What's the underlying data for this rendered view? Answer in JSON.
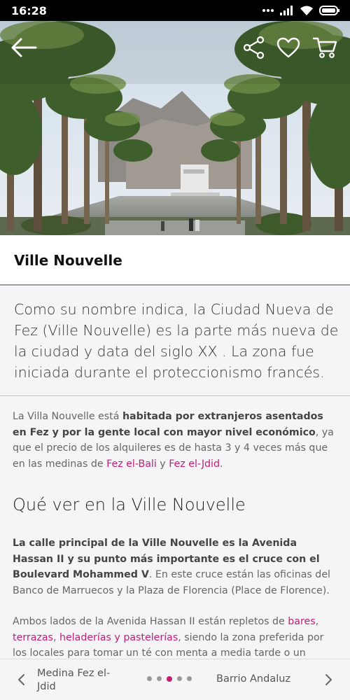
{
  "status_bar": {
    "time": "16:28",
    "icons": [
      "more-dots-icon",
      "signal-icon",
      "wifi-icon",
      "battery-icon"
    ]
  },
  "hero": {
    "icons": [
      "back-arrow-icon",
      "share-icon",
      "heart-icon",
      "cart-icon"
    ]
  },
  "page": {
    "title": "Ville Nouvelle"
  },
  "intro": {
    "text": "Como su nombre indica, la Ciudad Nueva de Fez (Ville Nouvelle)  es la parte más nueva de la ciudad y data del siglo XX . La zona fue iniciada durante el proteccionismo francés."
  },
  "article": {
    "p1": {
      "t1": "La Villa Nouvelle está ",
      "b1": "habitada por extranjeros asentados en Fez y por la gente local con mayor nivel económico",
      "t2": ", ya que el precio de los alquileres es de hasta 3 y 4 veces más que en las medinas de ",
      "link1": "Fez el-Bali",
      "t3": " y ",
      "link2": "Fez el-Jdid",
      "t4": "."
    },
    "heading": "Qué ver en la Ville Nouvelle",
    "p2": {
      "b1": "La calle principal de la Ville Nouvelle es la Avenida Hassan II y su punto más importante es el cruce con el Boulevard Mohammed V",
      "t1": ". En este cruce están las oficinas del Banco de Marruecos y la Plaza de Florencia (Place de Florence)."
    },
    "p3": {
      "t1": "Ambos lados de la Avenida Hassan II están repletos de ",
      "link1": "bares",
      "t2": ", ",
      "link2": "terrazas",
      "t3": ", ",
      "link3": "heladerías y pastelerías",
      "t4": ", siendo la zona preferida por los locales para tomar un té con menta a media tarde o un"
    }
  },
  "bottom_nav": {
    "prev_label": "Medina Fez el-Jdid",
    "next_label": "Barrio Andaluz",
    "page_count": 5,
    "active_page": 3
  },
  "colors": {
    "accent": "#c21e74",
    "background": "#f5f5f7",
    "text": "#666666"
  }
}
